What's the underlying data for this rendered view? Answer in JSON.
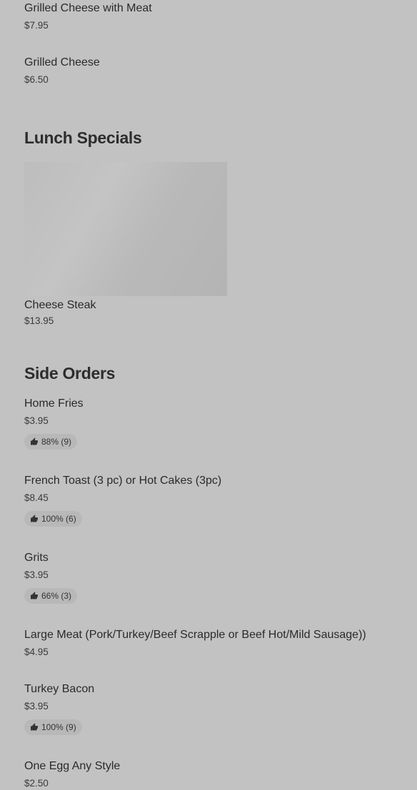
{
  "top_items": [
    {
      "name": "Grilled Cheese with Meat",
      "price": "$7.95"
    },
    {
      "name": "Grilled Cheese",
      "price": "$6.50"
    }
  ],
  "lunch_specials": {
    "title": "Lunch Specials",
    "items": [
      {
        "name": "Cheese Steak",
        "price": "$13.95"
      }
    ]
  },
  "side_orders": {
    "title": "Side Orders",
    "items": [
      {
        "name": "Home Fries",
        "price": "$3.95",
        "rating": "88% (9)"
      },
      {
        "name": "French Toast (3 pc) or Hot Cakes (3pc)",
        "price": "$8.45",
        "rating": "100% (6)"
      },
      {
        "name": "Grits",
        "price": "$3.95",
        "rating": "66% (3)"
      },
      {
        "name": "Large Meat (Pork/Turkey/Beef Scrapple or Beef Hot/Mild Sausage))",
        "price": "$4.95"
      },
      {
        "name": "Turkey Bacon",
        "price": "$3.95",
        "rating": "100% (9)"
      },
      {
        "name": "One Egg Any Style",
        "price": "$2.50"
      }
    ]
  },
  "icons": {
    "rating_icon": "thumbs-up-icon"
  }
}
